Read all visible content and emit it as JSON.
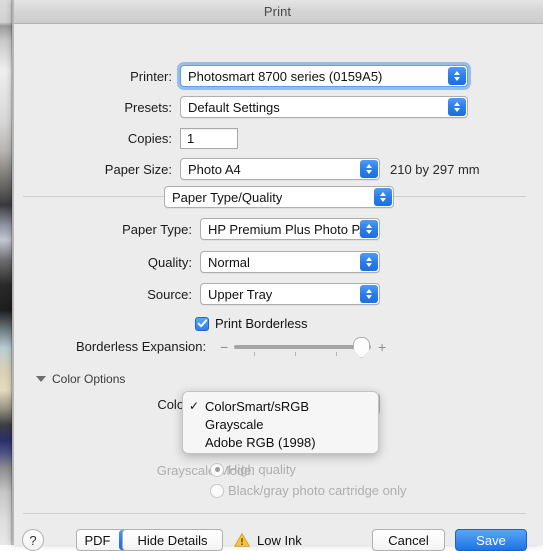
{
  "window": {
    "title": "Print"
  },
  "fields": {
    "printer": {
      "label": "Printer:",
      "value": "Photosmart 8700 series (0159A5)",
      "focused": true
    },
    "presets": {
      "label": "Presets:",
      "value": "Default Settings"
    },
    "copies": {
      "label": "Copies:",
      "value": "1"
    },
    "paper_size": {
      "label": "Paper Size:",
      "value": "Photo A4",
      "dimensions": "210 by 297 mm"
    },
    "pane": {
      "value": "Paper Type/Quality"
    },
    "paper_type": {
      "label": "Paper Type:",
      "value": "HP Premium Plus Photo P..."
    },
    "quality": {
      "label": "Quality:",
      "value": "Normal"
    },
    "source": {
      "label": "Source:",
      "value": "Upper Tray"
    },
    "print_borderless": {
      "label": "Print Borderless",
      "checked": true
    },
    "borderless_expansion": {
      "label": "Borderless Expansion:",
      "minus": "−",
      "plus": "+",
      "value_percent": 92
    },
    "color_options": {
      "label": "Color Options",
      "expanded": true
    },
    "color": {
      "label": "Color:",
      "value": "ColorSmart/sRGB"
    },
    "grayscale_mode": {
      "label": "Grayscale Mode:",
      "disabled": true,
      "options": [
        {
          "label": "High quality",
          "selected": true
        },
        {
          "label": "Black/gray photo cartridge only",
          "selected": false
        }
      ]
    }
  },
  "color_menu": {
    "checkmark": "✓",
    "items": [
      {
        "label": "ColorSmart/sRGB",
        "checked": true
      },
      {
        "label": "Grayscale",
        "checked": false
      },
      {
        "label": "Adobe RGB (1998)",
        "checked": false
      }
    ]
  },
  "bottom_bar": {
    "help": "?",
    "pdf": "PDF",
    "hide_details": "Hide Details",
    "low_ink": "Low Ink",
    "cancel": "Cancel",
    "save": "Save"
  },
  "colors": {
    "accent_blue": "#2b7de8",
    "primary_button": "#1e73e6",
    "dialog_bg": "#ececec",
    "warning_yellow": "#f3c33c",
    "disabled_text": "#aeaeae"
  }
}
